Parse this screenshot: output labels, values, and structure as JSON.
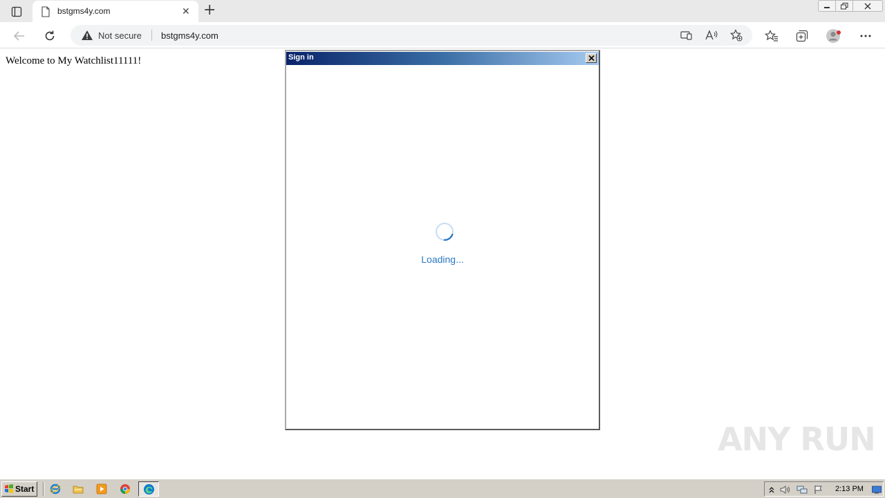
{
  "browser": {
    "tab": {
      "title": "bstgms4y.com"
    },
    "address_bar": {
      "security_label": "Not secure",
      "url": "bstgms4y.com"
    }
  },
  "page": {
    "welcome_text": "Welcome to My Watchlist11111!"
  },
  "dialog": {
    "title": "Sign in",
    "loading_text": "Loading..."
  },
  "watermark": {
    "text": "ANY RUN"
  },
  "taskbar": {
    "start_label": "Start",
    "clock": "2:13 PM"
  },
  "colors": {
    "accent": "#2a78c3",
    "titlebar_start": "#0a246a",
    "titlebar_end": "#a6caf0"
  }
}
